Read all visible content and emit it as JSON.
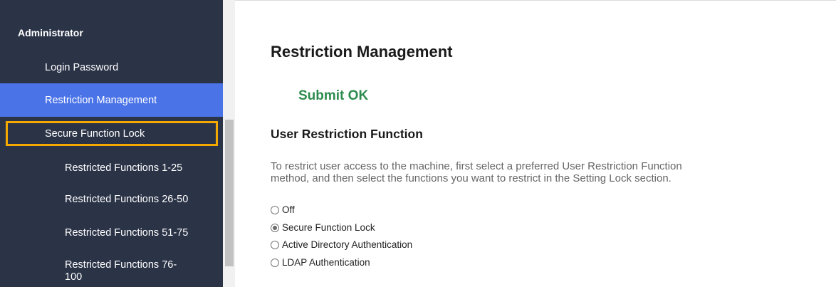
{
  "sidebar": {
    "heading": "Administrator",
    "items": [
      {
        "label": "Login Password",
        "level": 1,
        "state": "normal"
      },
      {
        "label": "Restriction Management",
        "level": 1,
        "state": "active"
      },
      {
        "label": "Secure Function Lock",
        "level": 1,
        "state": "highlighted"
      },
      {
        "label": "Restricted Functions 1-25",
        "level": 2,
        "state": "normal"
      },
      {
        "label": "Restricted Functions 26-50",
        "level": 2,
        "state": "normal"
      },
      {
        "label": "Restricted Functions 51-75",
        "level": 2,
        "state": "normal"
      },
      {
        "label_line1": "Restricted Functions 76-",
        "label_line2": "100",
        "level": 2,
        "state": "normal"
      }
    ]
  },
  "main": {
    "title": "Restriction Management",
    "status": "Submit OK",
    "section_title": "User Restriction Function",
    "description_line1": "To restrict user access to the machine, first select a preferred User Restriction Function",
    "description_line2": "method, and then select the functions you want to restrict in the Setting Lock section.",
    "options": [
      {
        "label": "Off",
        "checked": false
      },
      {
        "label": "Secure Function Lock",
        "checked": true
      },
      {
        "label": "Active Directory Authentication",
        "checked": false
      },
      {
        "label": "LDAP Authentication",
        "checked": false
      }
    ]
  },
  "colors": {
    "sidebar_bg": "#2b3347",
    "active_bg": "#4a73e8",
    "highlight_border": "#f5a800",
    "status_green": "#2e8b4e"
  },
  "icons": {
    "radio_unchecked": "radio-unchecked-icon",
    "radio_checked": "radio-checked-icon"
  }
}
